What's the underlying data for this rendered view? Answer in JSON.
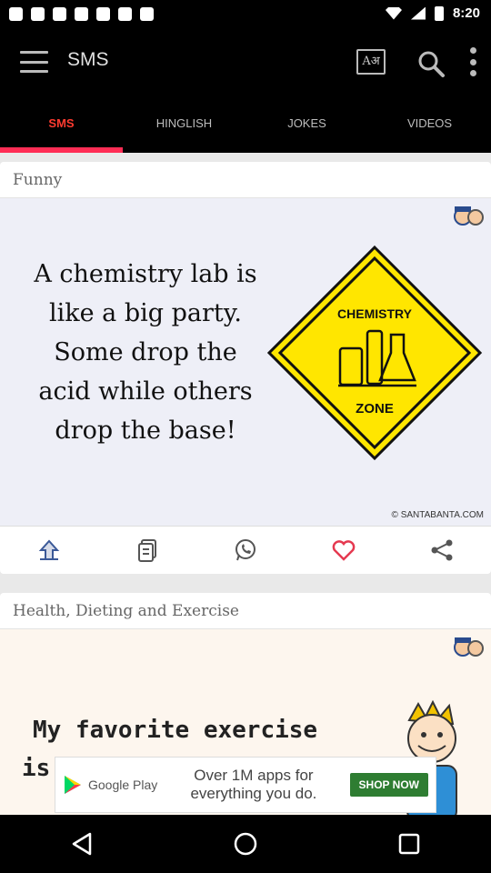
{
  "status_bar": {
    "time": "8:20"
  },
  "app_bar": {
    "title": "SMS",
    "font_label": "Aअ"
  },
  "tabs": [
    {
      "label": "SMS",
      "active": true
    },
    {
      "label": "HINGLISH",
      "active": false
    },
    {
      "label": "JOKES",
      "active": false
    },
    {
      "label": "VIDEOS",
      "active": false
    }
  ],
  "cards": [
    {
      "title": "Funny",
      "joke_lines": [
        "A chemistry lab is",
        "like a big party.",
        "Some drop the",
        "acid while others",
        "drop the base!"
      ],
      "sign_line1": "CHEMISTRY",
      "sign_line2": "ZONE",
      "copyright": "© SANTABANTA.COM"
    },
    {
      "title": "Health, Dieting and Exercise",
      "line1": "My favorite exercise",
      "line2": "is"
    }
  ],
  "ad": {
    "brand": "Google Play",
    "text": "Over 1M apps for everything you do.",
    "button": "SHOP NOW"
  },
  "colors": {
    "accent": "#ff2d55",
    "tab_active_text": "#ff3b30",
    "sign_yellow": "#ffe600",
    "heart": "#e53950"
  }
}
